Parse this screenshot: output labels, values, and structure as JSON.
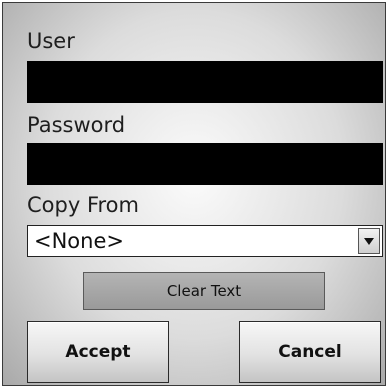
{
  "form": {
    "user_label": "User",
    "user_value": "",
    "password_label": "Password",
    "password_value": "",
    "copy_from_label": "Copy From",
    "copy_from_selected": "<None>",
    "clear_text_label": "Clear Text",
    "accept_label": "Accept",
    "cancel_label": "Cancel"
  },
  "icons": {
    "dropdown": "chevron-down-icon"
  },
  "colors": {
    "field_background": "#000000",
    "dialog_background": "#dcdcdc",
    "clear_button": "#a8a8a8"
  }
}
